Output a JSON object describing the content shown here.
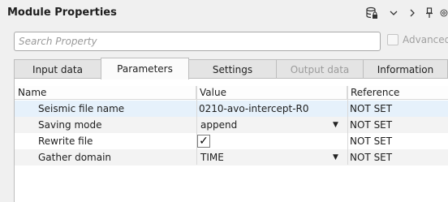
{
  "title": "Module Properties",
  "toolbar": {
    "icons": [
      "database-lock-icon",
      "chevron-down-icon",
      "chevron-right-icon",
      "pin-icon",
      "link-icon"
    ]
  },
  "search": {
    "placeholder": "Search Property",
    "value": ""
  },
  "advanced": {
    "label": "Advanced",
    "checked": false
  },
  "tabs": [
    {
      "label": "Input data",
      "active": false,
      "disabled": false
    },
    {
      "label": "Parameters",
      "active": true,
      "disabled": false
    },
    {
      "label": "Settings",
      "active": false,
      "disabled": false
    },
    {
      "label": "Output data",
      "active": false,
      "disabled": true
    },
    {
      "label": "Information",
      "active": false,
      "disabled": false
    }
  ],
  "table": {
    "headers": {
      "name": "Name",
      "value": "Value",
      "reference": "Reference"
    },
    "rows": [
      {
        "name": "Seismic file name",
        "value": "0210-avo-intercept-R0",
        "reference": "NOT SET",
        "kind": "text"
      },
      {
        "name": "Saving mode",
        "value": "append",
        "reference": "NOT SET",
        "kind": "dropdown"
      },
      {
        "name": "Rewrite file",
        "value": "✓",
        "reference": "NOT SET",
        "kind": "checkbox",
        "checked": true
      },
      {
        "name": "Gather domain",
        "value": "TIME",
        "reference": "NOT SET",
        "kind": "dropdown"
      }
    ]
  }
}
